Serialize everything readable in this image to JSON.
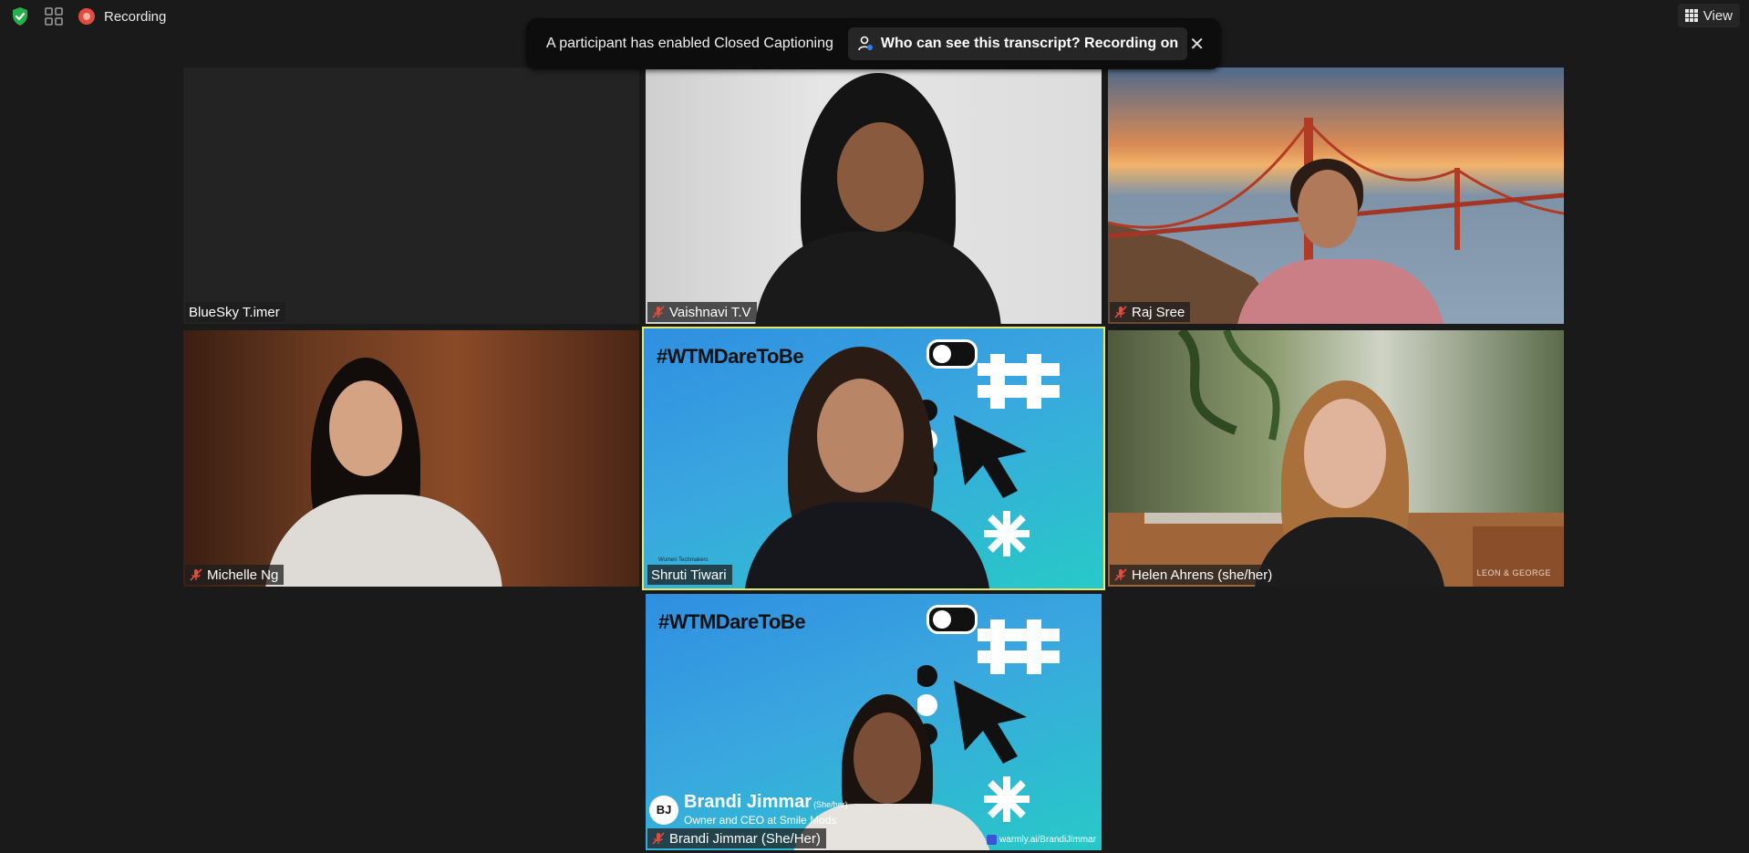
{
  "topbar": {
    "recording_label": "Recording",
    "view_label": "View"
  },
  "toast": {
    "message": "A participant has enabled Closed Captioning",
    "pill_text": "Who can see this transcript? Recording on",
    "close_glyph": "✕"
  },
  "participants": [
    {
      "name": "BlueSky T.imer",
      "muted": false,
      "active": false
    },
    {
      "name": "Vaishnavi T.V",
      "muted": true,
      "active": false
    },
    {
      "name": "Raj Sree",
      "muted": true,
      "active": false
    },
    {
      "name": "Michelle Ng",
      "muted": true,
      "active": false
    },
    {
      "name": "Shruti Tiwari",
      "muted": false,
      "active": true
    },
    {
      "name": "Helen Ahrens (she/her)",
      "muted": true,
      "active": false
    },
    {
      "name": "Brandi Jimmar (She/Her)",
      "muted": true,
      "active": false
    }
  ],
  "backgrounds": {
    "wtm_hashtag": "#WTMDareToBe",
    "wt_logo_text": "Women Techmakers",
    "brand_corner_text": "LEON & GEORGE",
    "lower_third": {
      "initials": "BJ",
      "name": "Brandi Jimmar",
      "pronouns": "(She/her)",
      "subtitle": "Owner and CEO at Smile Mods",
      "link": "warmly.ai/BrandiJimmar"
    }
  },
  "icons": {
    "shield": "shield-check-icon",
    "grid": "gallery-grid-icon",
    "record": "record-icon",
    "view": "view-grid-icon",
    "mic_off": "mic-off-icon",
    "transcript": "transcript-user-icon",
    "close": "close-icon"
  },
  "colors": {
    "background": "#1a1a1a",
    "active_speaker_border": "#e3e86a",
    "record_red": "#e04c3d",
    "mic_off_red": "#e04c3d",
    "shield_green": "#25b04a"
  }
}
